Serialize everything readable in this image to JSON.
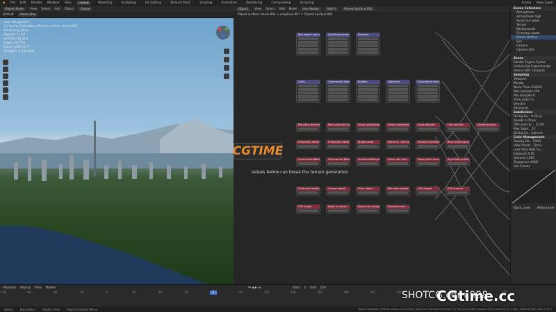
{
  "menu": {
    "items": [
      "File",
      "Edit",
      "Render",
      "Window",
      "Help"
    ],
    "workspaces": [
      "Layout",
      "Modeling",
      "Sculpting",
      "UV Editing",
      "Texture Paint",
      "Shading",
      "Animation",
      "Rendering",
      "Compositing",
      "Scripting"
    ],
    "active_workspace": "Layout",
    "scene": "Scene",
    "view_layer": "View Layer"
  },
  "viewport": {
    "mode": "Object Mode",
    "menus": [
      "View",
      "Select",
      "Add",
      "Object"
    ],
    "transform": "Global",
    "orientation": "Default",
    "drag": "Select Box",
    "overlay_lines": [
      "User Perspective",
      "(1) Scene Collection | Planet surface chunk.001",
      "Rendering Done",
      "Objects   1 | 10",
      "Vertices  39,216",
      "Edges    29,770",
      "Faces    3,993,617",
      "Triangles 3,133,460"
    ]
  },
  "node_editor": {
    "menus": [
      "Object",
      "View",
      "Select",
      "Add",
      "Node"
    ],
    "use_nodes": "Use Nodes",
    "slot": "Slot 1",
    "material": "Planet Surface.001",
    "breadcrumb": "Planet surface chunk.001 > scaplane.001 > Planet Surface.001",
    "notice": "Values below can break the terrain generation",
    "blue_row1": [
      "Red desert and so...",
      "Lightfloat screen",
      "Blackfire"
    ],
    "blue_row2": [
      "Glass",
      "Commercial Zebra",
      "Bluedip",
      "Highdrive",
      "Superflat to serve"
    ],
    "red_row1": [
      "Mountain amount",
      "Red rocks and rock",
      "Snowy peaks start",
      "Snowy peaks end",
      "Snow altitude",
      "Hills amount",
      "Desert amount"
    ],
    "red_row2": [
      "Protected nature z...",
      "Protected nature s...",
      "Jungle value",
      "Plants in...and value",
      "Forests & farmlands",
      "Blue ocean value"
    ],
    "red_row3": [
      "Commercial Bathym...",
      "Commercial Bathym...",
      "Industrial Bathym...",
      "Urban city size",
      "Deep hydro density",
      "Superflat landfill-n"
    ],
    "red_row4": [
      "Continent height",
      "Canyon depth",
      "River depth",
      "Mountain height",
      "Hills height",
      "Cliff amount"
    ],
    "red_row5": [
      "Cliff height",
      "Noise in dunes",
      "Beach sand height",
      "Shoreline size"
    ]
  },
  "outliner": {
    "title": "Scene Collection",
    "items": [
      "Atmosphere",
      "atmosphere high",
      "Space sun glow",
      "Terrain",
      "Backgrounds",
      "Chimneys water",
      "Planet surface",
      "Sun",
      "Camera",
      "Camera.001"
    ]
  },
  "properties": {
    "rows": [
      "Scene",
      "Render Engine  Cycles",
      "Feature Set  Experimental",
      "Device  GPU Compute",
      "Sampling",
      "Viewport",
      "Render",
      "Noise Thres  0.0250",
      "Max Samples  256",
      "Min Samples  0",
      "Time Limit  0 s",
      "Denoise",
      "Advanced",
      "Subdivision",
      "Dicing Ra...  0.50 px",
      "Render  1.00 px",
      "Offscreen Sc...  25.00",
      "Max Subd...  12",
      "Dicing Ca...  Camera",
      "Color Management",
      "Display De...  sRGB",
      "View Transf...  Filmic",
      "Look  Very High Co...",
      "Exposure  0.00",
      "Gamma  1.000",
      "Sequencer  sRGB",
      "Use Curves"
    ],
    "curve_values": [
      "Black Level",
      "White Level"
    ]
  },
  "timeline": {
    "menus": [
      "Playback",
      "Keying",
      "View",
      "Marker"
    ],
    "ticks": [
      "-100",
      "-60",
      "-40",
      "-20",
      "0",
      "20",
      "40",
      "60",
      "80",
      "100",
      "120",
      "140",
      "160",
      "180",
      "200",
      "220",
      "240",
      "260",
      "280",
      "300"
    ],
    "start": "Start",
    "start_value": "1",
    "end": "End",
    "end_value": "250",
    "current_frame": "0"
  },
  "statusbar": {
    "items": [
      "Select",
      "Box Select",
      "Rotate View",
      "Object Context Menu"
    ],
    "right": "Scene Collection | Planet surface chunk.001 | Verts:79,216 | Faces:3,993,617 | Tris:3,133,460 | Objects:1/10 | Memory 6.11 GiB | VRAM 6.1/8.0 GiB | 2.93.0"
  },
  "watermark": {
    "badge": "CGTIME",
    "small": "SHOTCG.com.998",
    "large": "CGtime.cc"
  },
  "colors": {
    "accent": "#e88a2a",
    "node_blue": "#4b4d8d",
    "node_red": "#8b2a3a"
  }
}
